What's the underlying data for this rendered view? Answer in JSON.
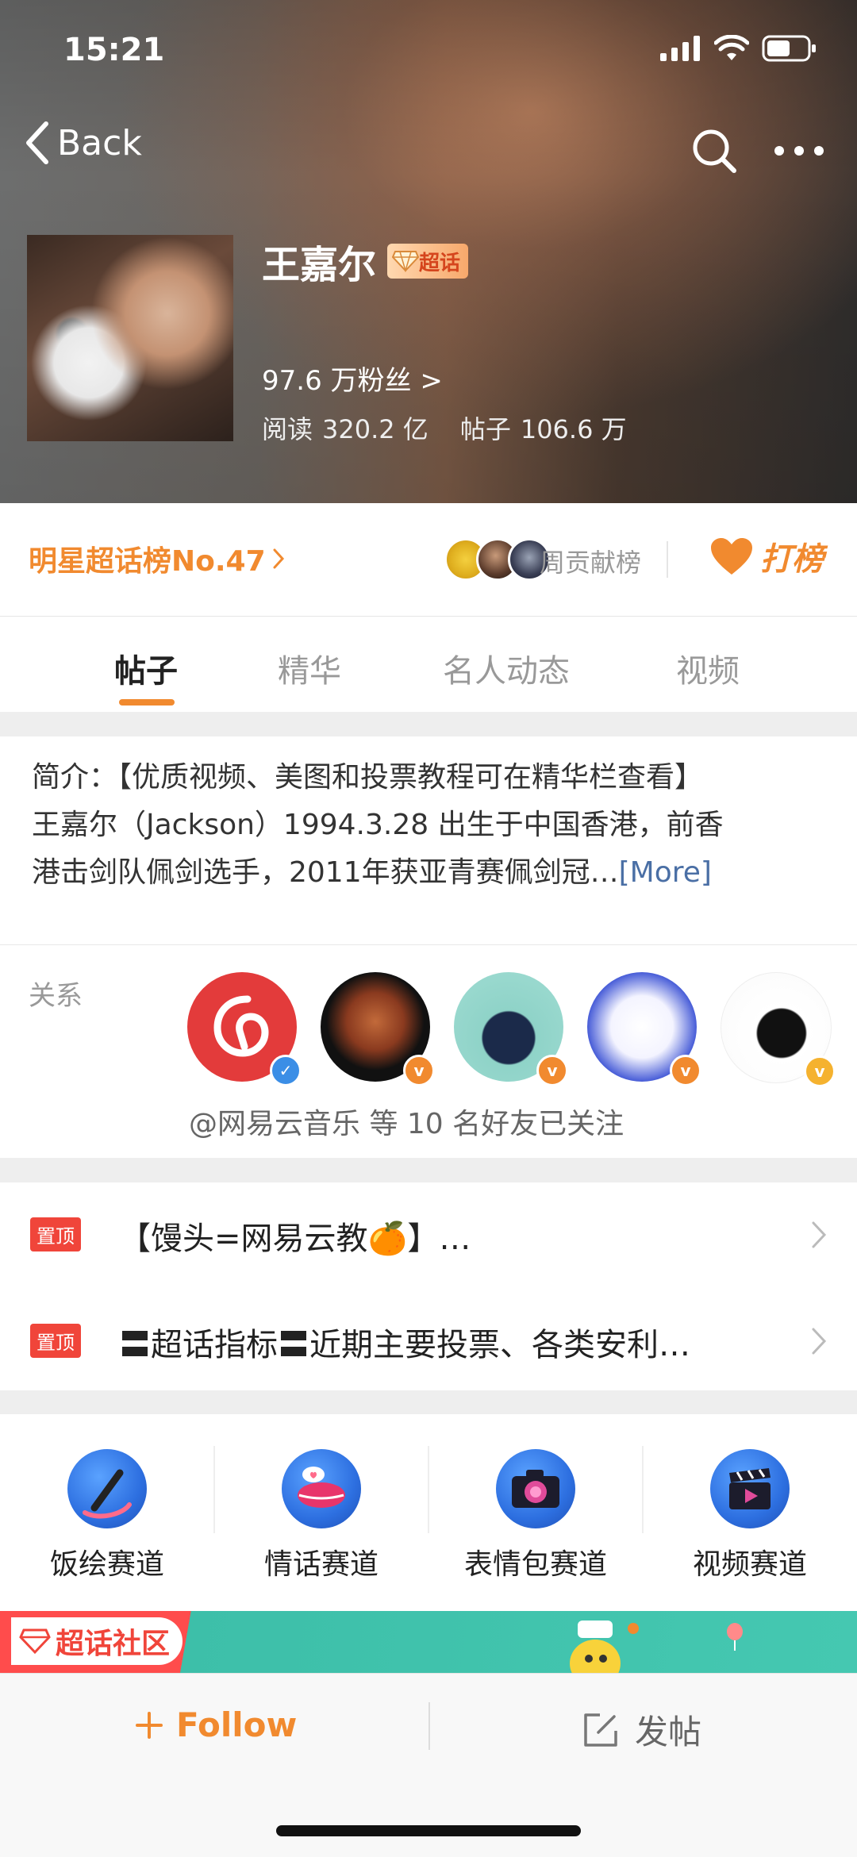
{
  "status_bar": {
    "time": "15:21"
  },
  "nav": {
    "back_label": "Back"
  },
  "profile": {
    "name": "王嘉尔",
    "badge": "超话",
    "fans": "97.6 万粉丝 >",
    "reads_label": "阅读",
    "reads_value": "320.2 亿",
    "posts_label": "帖子",
    "posts_value": "106.6 万"
  },
  "rank": {
    "label": "明星超话榜No.47",
    "weekly": "周贡献榜",
    "dabang": "打榜"
  },
  "tabs": [
    "帖子",
    "精华",
    "名人动态",
    "视频"
  ],
  "intro": {
    "line1": "简介：【优质视频、美图和投票教程可在精华栏查看】",
    "line2": "王嘉尔（Jackson）1994.3.28 出生于中国香港，前香",
    "line3": "港击剑队佩剑选手，2011年获亚青赛佩剑冠…",
    "more": "[More]"
  },
  "relations": {
    "label": "关系",
    "caption": "@网易云音乐 等 10 名好友已关注"
  },
  "pinned": {
    "tag": "置顶",
    "items": [
      {
        "text": "【馒头=网易云教🍊】…"
      },
      {
        "text": "〓超话指标〓近期主要投票、各类安利…"
      }
    ]
  },
  "tracks": [
    "饭绘赛道",
    "情话赛道",
    "表情包赛道",
    "视频赛道"
  ],
  "banner": {
    "title": "超话社区"
  },
  "bottom": {
    "follow": "Follow",
    "post": "发帖"
  },
  "colors": {
    "accent": "#f18a2f",
    "pin": "#f0453a",
    "link": "#4a6fa5"
  }
}
